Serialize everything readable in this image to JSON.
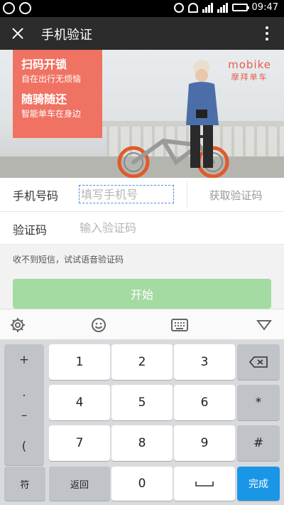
{
  "status_bar": {
    "time": "09:47"
  },
  "header": {
    "title": "手机验证",
    "close_icon": "close-icon",
    "more_icon": "more-vertical-icon"
  },
  "banner": {
    "promo": {
      "line1_title": "扫码开锁",
      "line1_sub": "自在出行无烦恼",
      "line2_title": "随骑随还",
      "line2_sub": "智能单车在身边"
    },
    "logo": {
      "en": "mobike",
      "cn": "摩拜单车"
    }
  },
  "form": {
    "phone_label": "手机号码",
    "phone_placeholder": "填写手机号",
    "get_code_label": "获取验证码",
    "code_label": "验证码",
    "code_placeholder": "输入验证码",
    "voice_hint": "收不到短信，试试语音验证码",
    "start_label": "开始"
  },
  "keyboard": {
    "toolbar": [
      "settings-icon",
      "emoji-icon",
      "keyboard-icon",
      "collapse-icon"
    ],
    "symbols": [
      "+",
      ".",
      "–",
      "("
    ],
    "digits": [
      "1",
      "2",
      "3",
      "4",
      "5",
      "6",
      "7",
      "8",
      "9"
    ],
    "right_keys": [
      "⌫",
      "*",
      "#"
    ],
    "bottom": {
      "symbols_key": "符",
      "back_key": "返回",
      "zero_key": "0",
      "space_key": "␣",
      "done_key": "完成"
    }
  },
  "colors": {
    "accent_green": "#a3dba3",
    "promo_red": "#f07263",
    "done_blue": "#1a96e6"
  }
}
